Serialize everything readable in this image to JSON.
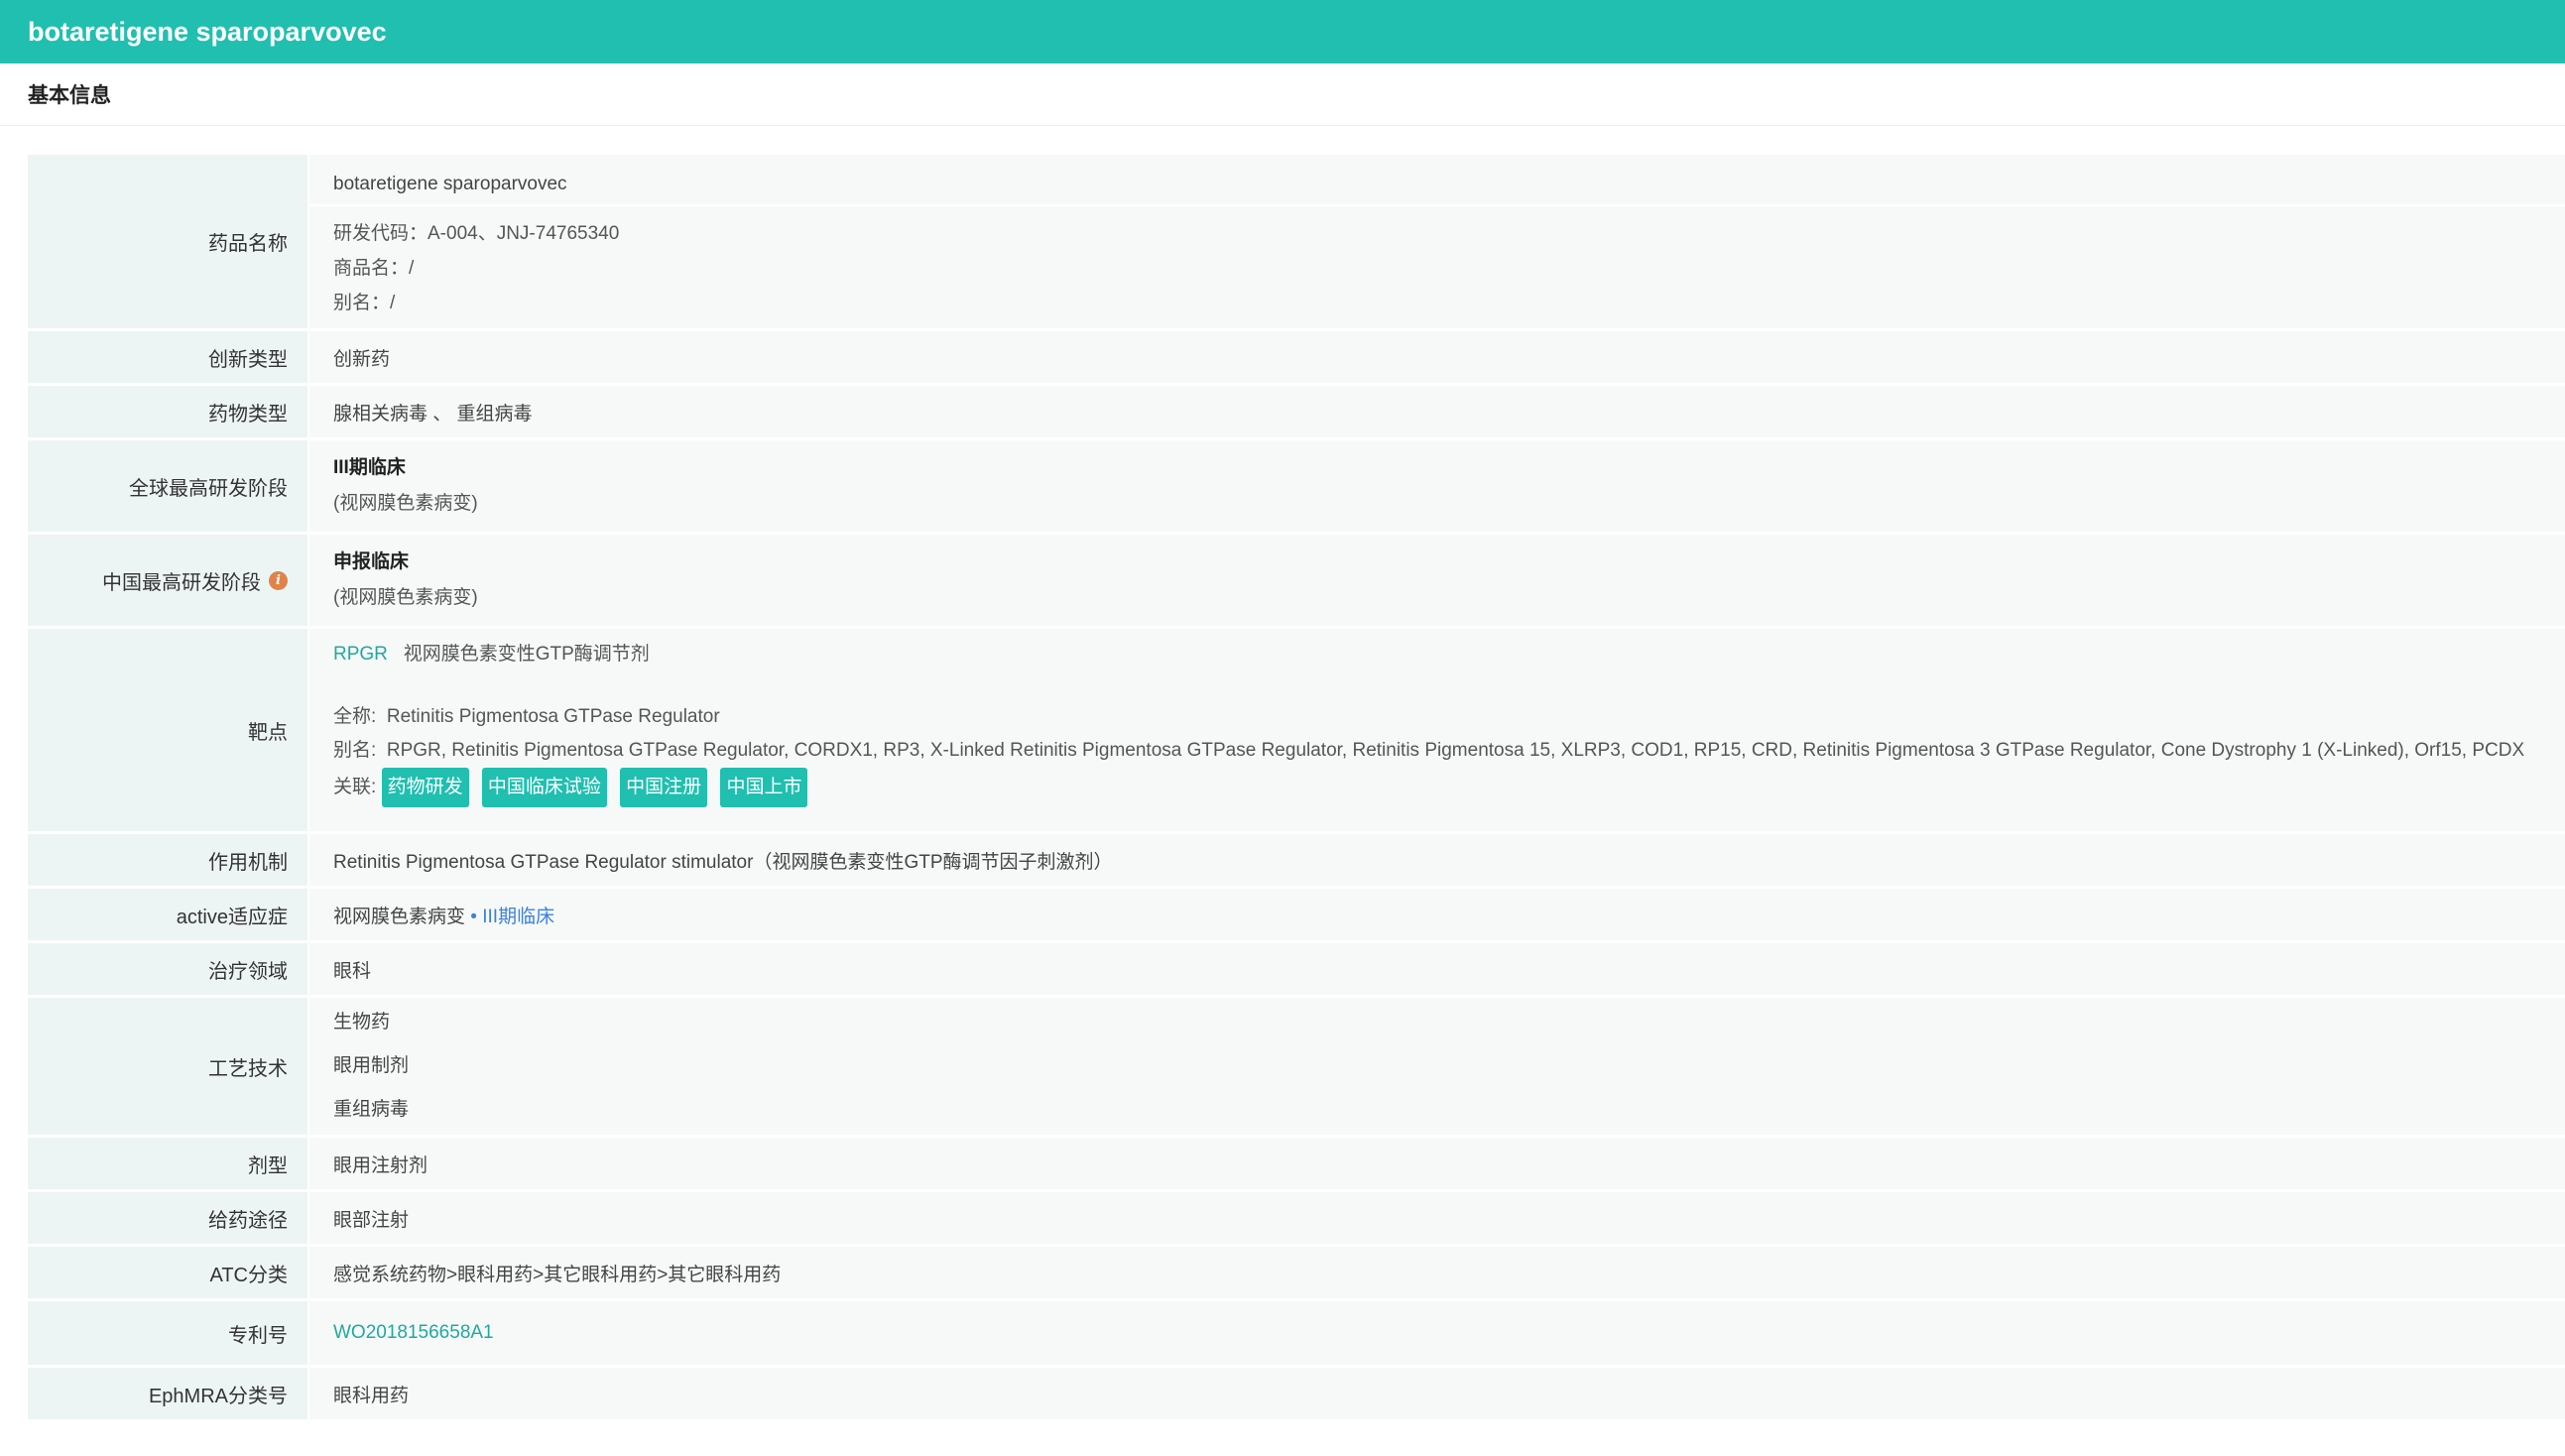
{
  "header": {
    "title": "botaretigene sparoparvovec"
  },
  "section": {
    "title": "基本信息"
  },
  "rows": {
    "name": {
      "label": "药品名称",
      "primary": "botaretigene sparoparvovec",
      "code": "研发代码：A-004、JNJ-74765340",
      "trade": "商品名：/",
      "alias": "别名：/"
    },
    "innovation": {
      "label": "创新类型",
      "value": "创新药"
    },
    "drug_type": {
      "label": "药物类型",
      "value": "腺相关病毒 、 重组病毒"
    },
    "global_phase": {
      "label": "全球最高研发阶段",
      "phase": "III期临床",
      "indication": "(视网膜色素病变)"
    },
    "china_phase": {
      "label": "中国最高研发阶段",
      "phase": "申报临床",
      "indication": "(视网膜色素病变)"
    },
    "target": {
      "label": "靶点",
      "symbol": "RPGR",
      "symbol_desc": "视网膜色素变性GTP酶调节剂",
      "fullname_label": "全称:",
      "fullname": "Retinitis Pigmentosa GTPase Regulator",
      "alias_label": "别名:",
      "alias": "RPGR, Retinitis Pigmentosa GTPase Regulator, CORDX1, RP3, X-Linked Retinitis Pigmentosa GTPase Regulator, Retinitis Pigmentosa 15, XLRP3, COD1, RP15, CRD, Retinitis Pigmentosa 3 GTPase Regulator, Cone Dystrophy 1 (X-Linked), Orf15, PCDX",
      "related_label": "关联:",
      "tags": [
        "药物研发",
        "中国临床试验",
        "中国注册",
        "中国上市"
      ]
    },
    "mechanism": {
      "label": "作用机制",
      "value": "Retinitis Pigmentosa GTPase Regulator stimulator（视网膜色素变性GTP酶调节因子刺激剂）"
    },
    "active_indication": {
      "label": "active适应症",
      "value": "视网膜色素病变",
      "phase": "• III期临床"
    },
    "therapy_area": {
      "label": "治疗领域",
      "value": "眼科"
    },
    "technology": {
      "label": "工艺技术",
      "values": [
        "生物药",
        "眼用制剂",
        "重组病毒"
      ]
    },
    "dosage_form": {
      "label": "剂型",
      "value": "眼用注射剂"
    },
    "route": {
      "label": "给药途径",
      "value": "眼部注射"
    },
    "atc": {
      "label": "ATC分类",
      "value": "感觉系统药物>眼科用药>其它眼科用药>其它眼科用药"
    },
    "patent": {
      "label": "专利号",
      "value": "WO2018156658A1"
    },
    "ephmra": {
      "label": "EphMRA分类号",
      "value": "眼科用药"
    }
  },
  "colors": {
    "accent": "#20bfb0",
    "label_bg": "#edf5f4",
    "value_bg": "#f7f9f9",
    "info_icon": "#e0834a",
    "link_blue": "#3b82e0"
  },
  "icons": {
    "china_phase_info": "info-icon"
  }
}
